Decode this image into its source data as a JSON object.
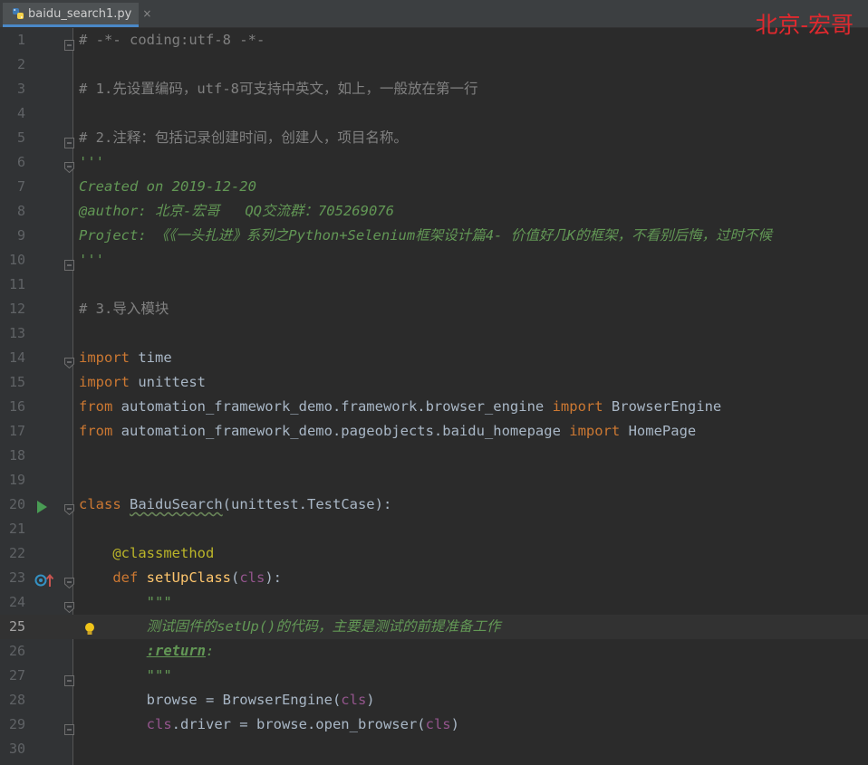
{
  "tab": {
    "filename": "baidu_search1.py",
    "close": "×"
  },
  "watermark": "北京-宏哥",
  "code_lines": [
    {
      "n": "1",
      "segments": [
        [
          "c-comment",
          "# -*- coding:utf-8 -*-"
        ]
      ],
      "fold": "start"
    },
    {
      "n": "2",
      "segments": []
    },
    {
      "n": "3",
      "segments": [
        [
          "c-comment",
          "# 1.先设置编码，utf-8可支持中英文，如上，一般放在第一行"
        ]
      ]
    },
    {
      "n": "4",
      "segments": []
    },
    {
      "n": "5",
      "segments": [
        [
          "c-comment",
          "# 2.注释：包括记录创建时间，创建人，项目名称。"
        ]
      ],
      "fold": "start"
    },
    {
      "n": "6",
      "segments": [
        [
          "c-doc",
          "'''"
        ]
      ],
      "fold": "end"
    },
    {
      "n": "7",
      "segments": [
        [
          "c-doc",
          "Created on 2019-12-20"
        ]
      ]
    },
    {
      "n": "8",
      "segments": [
        [
          "c-doc",
          "@author: 北京-宏哥   QQ交流群：705269076"
        ]
      ]
    },
    {
      "n": "9",
      "segments": [
        [
          "c-doc",
          "Project: 《《一头扎进》系列之Python+Selenium框架设计篇4- 价值好几K的框架，不看别后悔，过时不候"
        ]
      ]
    },
    {
      "n": "10",
      "segments": [
        [
          "c-doc",
          "'''"
        ]
      ],
      "fold": "start"
    },
    {
      "n": "11",
      "segments": []
    },
    {
      "n": "12",
      "segments": [
        [
          "c-comment",
          "# 3.导入模块"
        ]
      ]
    },
    {
      "n": "13",
      "segments": []
    },
    {
      "n": "14",
      "segments": [
        [
          "c-kw",
          "import"
        ],
        [
          "",
          " time"
        ]
      ],
      "fold": "end"
    },
    {
      "n": "15",
      "segments": [
        [
          "c-kw",
          "import"
        ],
        [
          "",
          " unittest"
        ]
      ]
    },
    {
      "n": "16",
      "segments": [
        [
          "c-kw",
          "from"
        ],
        [
          "",
          " automation_framework_demo.framework.browser_engine "
        ],
        [
          "c-kw",
          "import"
        ],
        [
          "",
          " BrowserEngine"
        ]
      ]
    },
    {
      "n": "17",
      "segments": [
        [
          "c-kw",
          "from"
        ],
        [
          "",
          " automation_framework_demo.pageobjects.baidu_homepage "
        ],
        [
          "c-kw",
          "import"
        ],
        [
          "",
          " HomePage"
        ]
      ]
    },
    {
      "n": "18",
      "segments": []
    },
    {
      "n": "19",
      "segments": []
    },
    {
      "n": "20",
      "segments": [
        [
          "c-kw",
          "class"
        ],
        [
          "",
          " "
        ],
        [
          "c-cls",
          "BaiduSearch"
        ],
        [
          "",
          "(unittest.TestCase):"
        ]
      ],
      "fold": "end",
      "gutter_icon": "run"
    },
    {
      "n": "21",
      "segments": []
    },
    {
      "n": "22",
      "segments": [
        [
          "",
          "    "
        ],
        [
          "c-dec",
          "@classmethod"
        ]
      ]
    },
    {
      "n": "23",
      "segments": [
        [
          "",
          "    "
        ],
        [
          "c-kw",
          "def"
        ],
        [
          "",
          " "
        ],
        [
          "c-fn",
          "setUpClass"
        ],
        [
          "",
          "("
        ],
        [
          "c-self",
          "cls"
        ],
        [
          "",
          "):"
        ]
      ],
      "fold": "end",
      "gutter_icon": "override"
    },
    {
      "n": "24",
      "segments": [
        [
          "",
          "        "
        ],
        [
          "c-doc",
          "\"\"\""
        ]
      ],
      "fold": "end"
    },
    {
      "n": "25",
      "segments": [
        [
          "",
          "        "
        ],
        [
          "c-doc",
          "测试固件的setUp()的代码，主要是测试的前提准备工作"
        ]
      ],
      "current": true,
      "gutter_icon": "bulb"
    },
    {
      "n": "26",
      "segments": [
        [
          "",
          "        "
        ],
        [
          "c-tag",
          ":return"
        ],
        [
          "c-doc",
          ":"
        ]
      ]
    },
    {
      "n": "27",
      "segments": [
        [
          "",
          "        "
        ],
        [
          "c-doc",
          "\"\"\""
        ]
      ],
      "fold": "start"
    },
    {
      "n": "28",
      "segments": [
        [
          "",
          "        browse = BrowserEngine("
        ],
        [
          "c-self",
          "cls"
        ],
        [
          "",
          ")"
        ]
      ]
    },
    {
      "n": "29",
      "segments": [
        [
          "",
          "        "
        ],
        [
          "c-self",
          "cls"
        ],
        [
          "",
          ".driver = browse.open_browser("
        ],
        [
          "c-self",
          "cls"
        ],
        [
          "",
          ")"
        ]
      ],
      "fold": "start"
    },
    {
      "n": "30",
      "segments": []
    }
  ]
}
